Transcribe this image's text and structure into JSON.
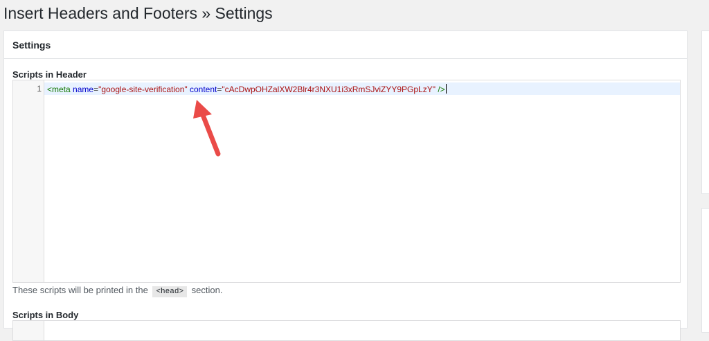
{
  "page": {
    "title": "Insert Headers and Footers » Settings"
  },
  "panel": {
    "title": "Settings"
  },
  "header_scripts": {
    "label": "Scripts in Header",
    "line_number": "1",
    "code": {
      "open": "<meta",
      "attr1": "name",
      "eq": "=",
      "val1": "\"google-site-verification\"",
      "attr2": "content",
      "val2": "\"cAcDwpOHZalXW2Blr4r3NXU1i3xRmSJviZYY9PGpLzY\"",
      "close": "/>"
    },
    "help_before": "These scripts will be printed in the",
    "help_code": "<head>",
    "help_after": "section."
  },
  "body_scripts": {
    "label": "Scripts in Body"
  },
  "colors": {
    "arrow": "#ea4b48",
    "tag": "#117700",
    "attribute": "#0000cc",
    "string": "#aa1111",
    "active_line": "#e8f2ff"
  }
}
